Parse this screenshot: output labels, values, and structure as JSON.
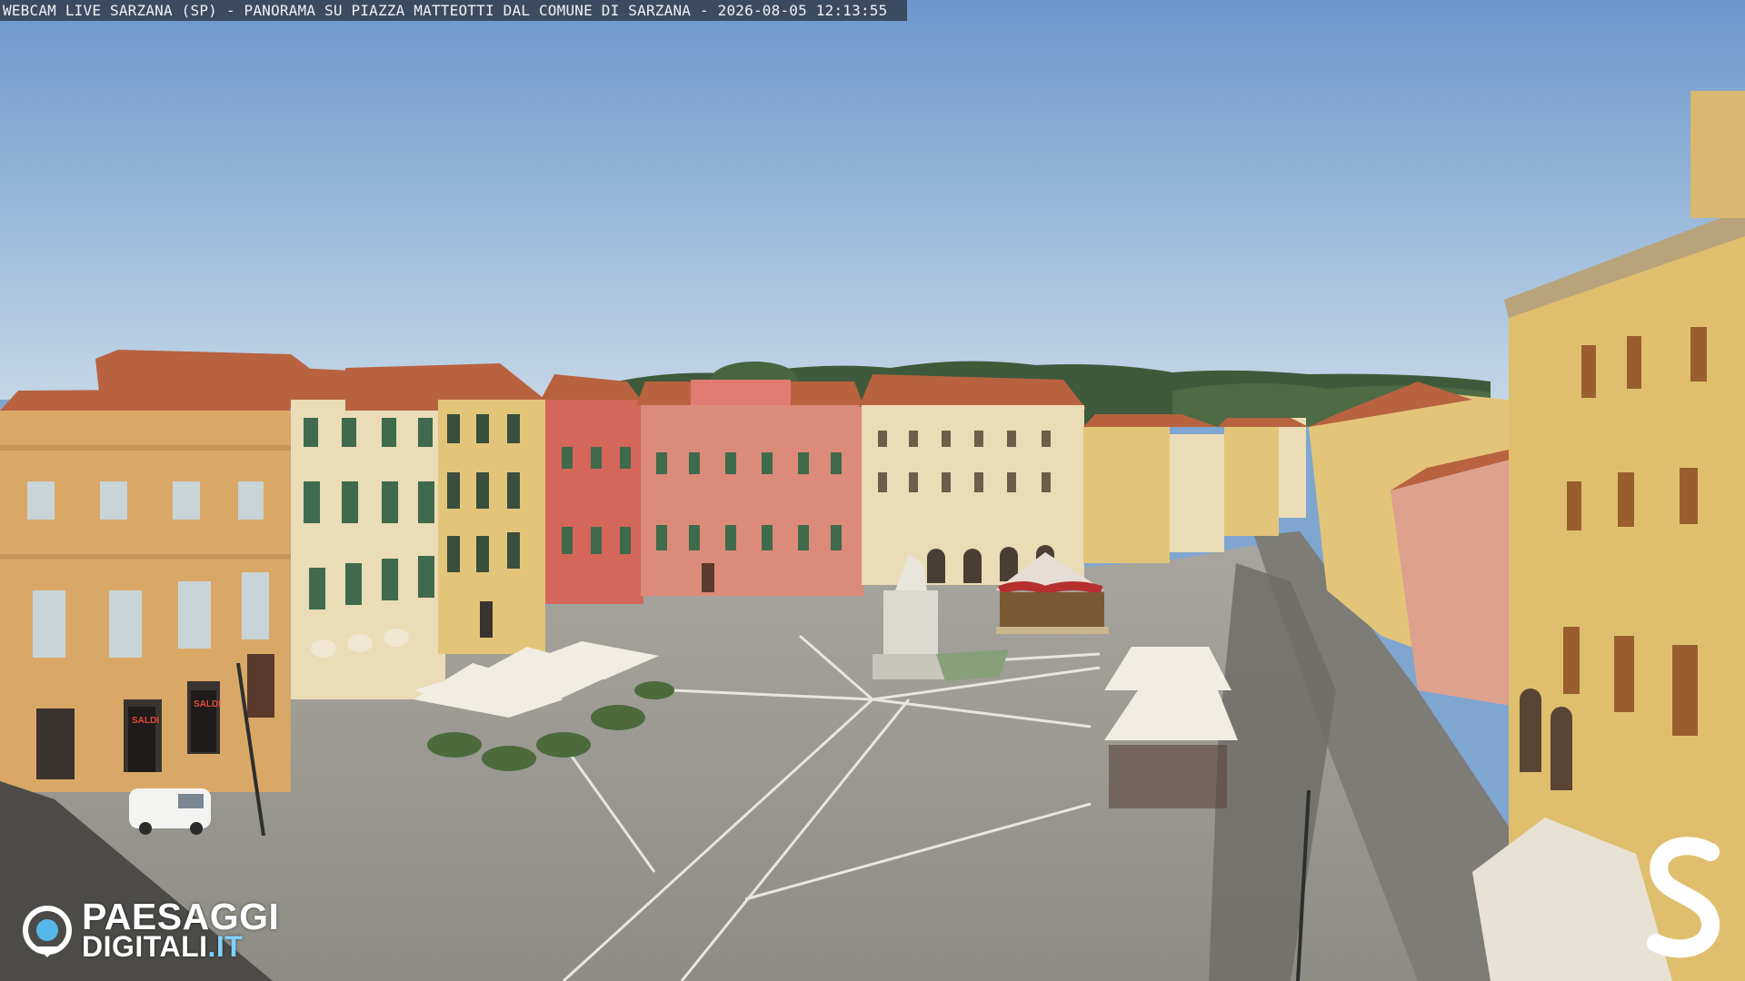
{
  "overlay": {
    "caption": "WEBCAM LIVE SARZANA (SP) - PANORAMA SU PIAZZA MATTEOTTI DAL COMUNE DI SARZANA - 2026-08-05  12:13:55"
  },
  "branding": {
    "line1": "PAESAGGI",
    "line2_main": "DIGITALI",
    "line2_tld": ".IT",
    "accent_color": "#56b7ea",
    "icon": "eye-icon"
  },
  "corner_logo": {
    "icon": "s-letter-logo"
  },
  "storefront_signs": {
    "sign_a": "SALDI",
    "sign_b": "SALDI"
  },
  "colors": {
    "sky_top": "#6a97cc",
    "sky_bottom": "#c3d6e6",
    "pavement": "#9b9a93",
    "pavement_lines": "#e8e6df",
    "roof_tiles": "#b8623f",
    "facade_ochre": "#d9a867",
    "facade_cream": "#e9dcb6",
    "facade_pink": "#d97c6f",
    "facade_red": "#d4665a",
    "facade_yellow": "#e3c57a",
    "shutters_green": "#3f6a4c",
    "hills": "#3e5a3a",
    "umbrellas": "#f1ede3"
  }
}
